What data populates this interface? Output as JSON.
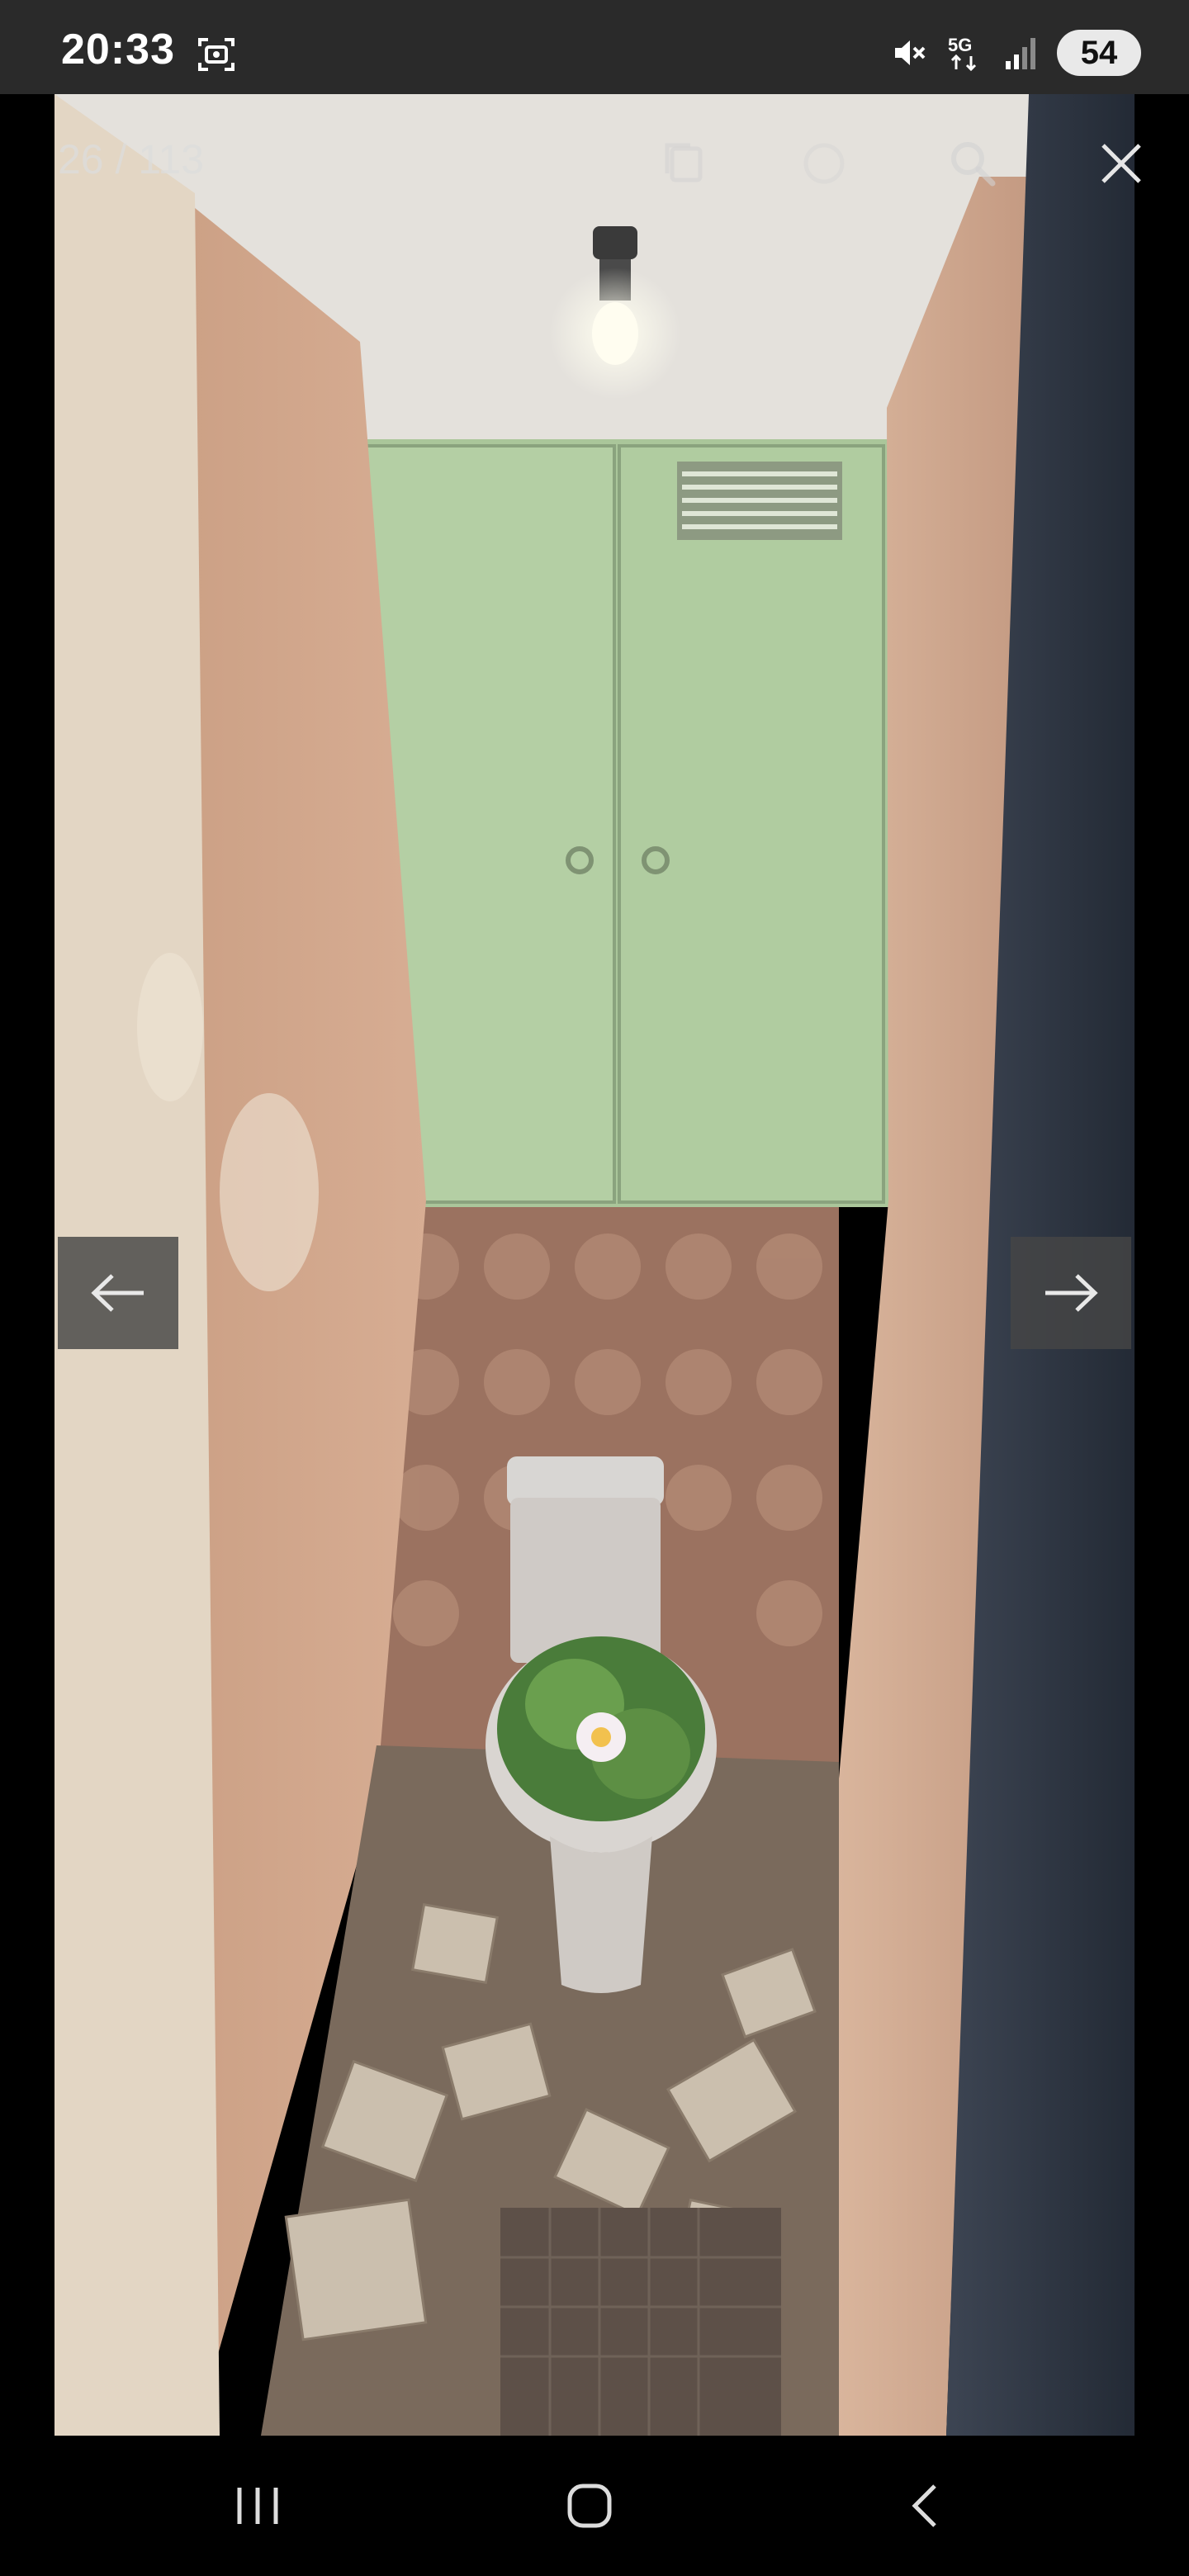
{
  "status_bar": {
    "time": "20:33",
    "icons": [
      "screenshot-icon",
      "mute-icon",
      "5g-icon",
      "signal-icon"
    ],
    "network": "5G",
    "battery": "54"
  },
  "viewer": {
    "counter": "26 / 113",
    "toolbar_icons": [
      "copy-icon",
      "info-icon",
      "search-icon",
      "close-icon"
    ],
    "prev_icon": "arrow-left-icon",
    "next_icon": "arrow-right-icon",
    "photo_subject": "toilet-room-renovation-photo"
  },
  "nav_bar": {
    "icons": [
      "recents-icon",
      "home-icon",
      "back-icon"
    ]
  },
  "colors": {
    "status_bg": "#2a2a2a",
    "viewer_bg": "#000000",
    "arrow_bg": "#464646",
    "cabinet_green": "#b2cda3",
    "wall_plaster": "#cfa38a"
  }
}
